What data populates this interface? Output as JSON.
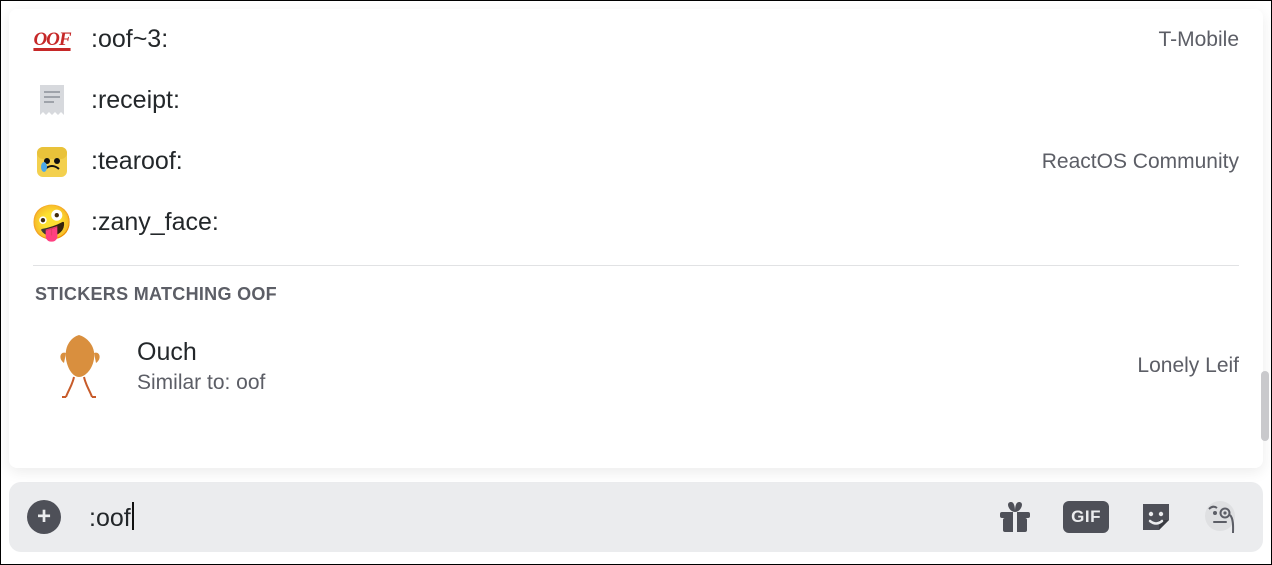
{
  "emojis": [
    {
      "name": ":oof~3:",
      "server": "T-Mobile",
      "icon": "oof-badge"
    },
    {
      "name": ":receipt:",
      "server": "",
      "icon": "receipt"
    },
    {
      "name": ":tearoof:",
      "server": "ReactOS Community",
      "icon": "tearoof"
    },
    {
      "name": ":zany_face:",
      "server": "",
      "icon": "zany"
    }
  ],
  "stickers_header": "STICKERS MATCHING oof",
  "sticker": {
    "name": "Ouch",
    "sub": "Similar to: oof",
    "source": "Lonely Leif"
  },
  "input": {
    "value": ":oof"
  },
  "icons": {
    "add": "+",
    "gif": "GIF"
  }
}
